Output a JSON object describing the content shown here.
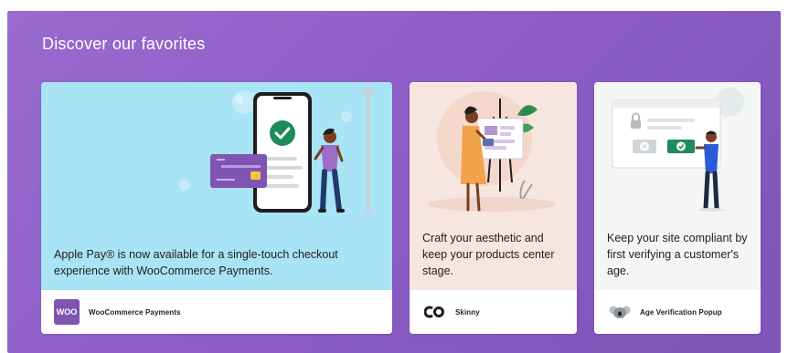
{
  "section": {
    "title": "Discover our favorites"
  },
  "cards": [
    {
      "description": "Apple Pay® is now available for a single-touch checkout experience with WooCommerce Payments.",
      "brand": "WooCommerce Payments",
      "logo_text": "WOO"
    },
    {
      "description": "Craft your aesthetic and keep your products center stage.",
      "brand": "Skinny"
    },
    {
      "description": "Keep your site compliant by first verifying a customer's age.",
      "brand": "Age Verification Popup"
    }
  ],
  "colors": {
    "panel": "#8a5cc4",
    "woo_purple": "#7f54b3",
    "check_green": "#1f8a5a"
  }
}
